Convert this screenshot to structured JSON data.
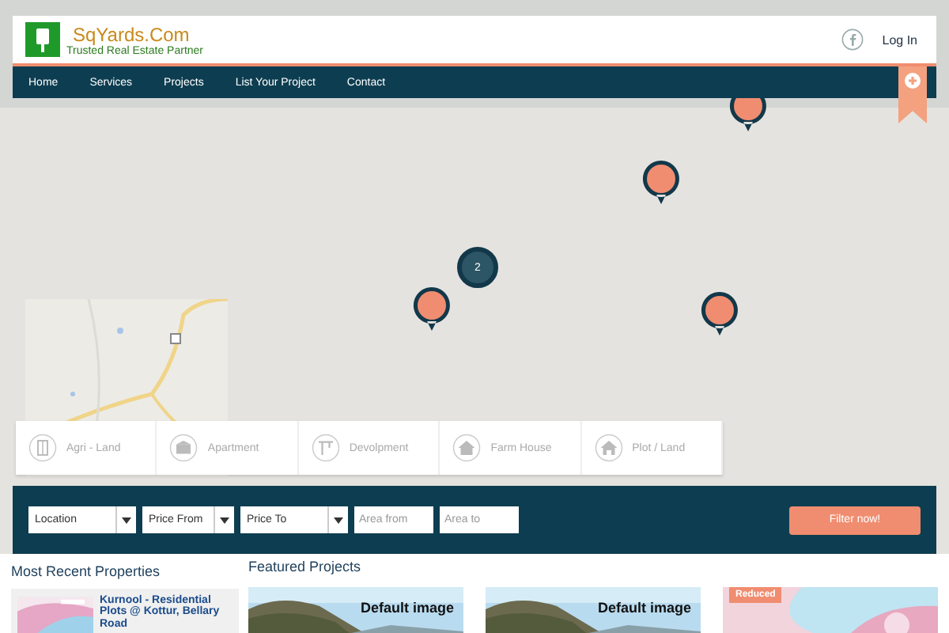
{
  "header": {
    "brand": "SqYards.Com",
    "tagline": "Trusted Real Estate Partner",
    "login": "Log In"
  },
  "nav": {
    "items": [
      {
        "label": "Home"
      },
      {
        "label": "Services"
      },
      {
        "label": "Projects"
      },
      {
        "label": "List Your Project"
      },
      {
        "label": "Contact"
      }
    ]
  },
  "map": {
    "markers": [
      {
        "kind": "pin"
      },
      {
        "kind": "pin"
      },
      {
        "kind": "cluster",
        "count": "2"
      },
      {
        "kind": "pin"
      },
      {
        "kind": "pin"
      }
    ]
  },
  "categories": [
    {
      "label": "Agri - Land"
    },
    {
      "label": "Apartment"
    },
    {
      "label": "Devolpment"
    },
    {
      "label": "Farm House"
    },
    {
      "label": "Plot / Land"
    }
  ],
  "filter": {
    "fields": [
      {
        "kind": "select",
        "value": "Location"
      },
      {
        "kind": "select",
        "value": "Price From"
      },
      {
        "kind": "select",
        "value": "Price To"
      },
      {
        "kind": "input",
        "placeholder": "Area from"
      },
      {
        "kind": "input",
        "placeholder": "Area to"
      }
    ],
    "button": "Filter now!"
  },
  "recent": {
    "title": "Most Recent Properties",
    "items": [
      {
        "title": "Kurnool - Residential Plots @ Kottur, Bellary Road"
      }
    ]
  },
  "featured": {
    "title": "Featured Projects",
    "items": [
      {
        "kind": "default",
        "caption": "Default image"
      },
      {
        "kind": "default",
        "caption": "Default image"
      },
      {
        "kind": "brochure",
        "badge": "Reduced"
      }
    ]
  }
}
